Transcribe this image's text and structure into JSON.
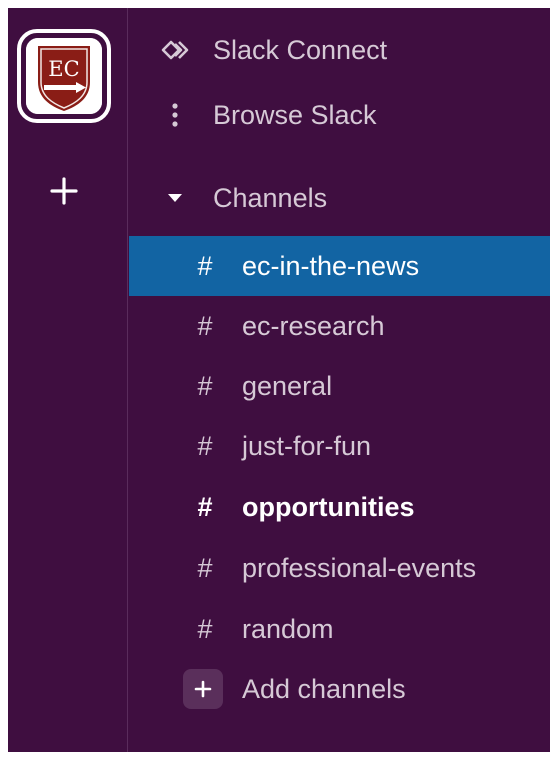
{
  "workspace": {
    "icon_name": "workspace-ec-shield-icon",
    "logo_text": "EC",
    "add_icon": "plus-icon"
  },
  "nav": {
    "slack_connect": {
      "label": "Slack Connect",
      "icon": "slack-connect-icon"
    },
    "browse_slack": {
      "label": "Browse Slack",
      "icon": "vertical-ellipsis-icon"
    }
  },
  "channels": {
    "header_label": "Channels",
    "header_icon": "caret-down-icon",
    "hash_symbol": "#",
    "items": [
      {
        "name": "ec-in-the-news",
        "state": "active"
      },
      {
        "name": "ec-research",
        "state": "normal"
      },
      {
        "name": "general",
        "state": "normal"
      },
      {
        "name": "just-for-fun",
        "state": "normal"
      },
      {
        "name": "opportunities",
        "state": "unread"
      },
      {
        "name": "professional-events",
        "state": "normal"
      },
      {
        "name": "random",
        "state": "normal"
      }
    ],
    "add_label": "Add channels",
    "add_icon": "plus-icon"
  },
  "colors": {
    "sidebar_bg": "#3f0e40",
    "active_bg": "#1264a3",
    "text": "#d6c9d6",
    "text_bright": "#ffffff",
    "logo_shield": "#8a1d16"
  }
}
